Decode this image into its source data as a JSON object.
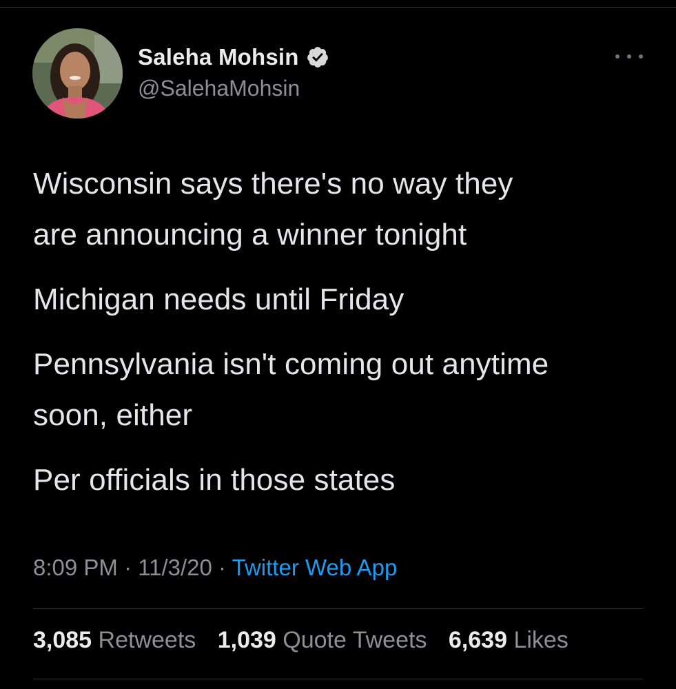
{
  "author": {
    "display_name": "Saleha Mohsin",
    "handle": "@SalehaMohsin",
    "verified": true,
    "verified_color": "#d9d9d9"
  },
  "menu": {
    "icon": "more-horizontal-icon"
  },
  "tweet": {
    "paragraphs": [
      "Wisconsin says there's no way they\nare announcing a winner tonight",
      "Michigan needs until Friday",
      "Pennsylvania isn't coming out anytime\nsoon, either",
      "Per officials in those states"
    ]
  },
  "meta": {
    "time": "8:09 PM",
    "separator": " · ",
    "date": "11/3/20",
    "source": "Twitter Web App"
  },
  "stats": {
    "retweets_count": "3,085",
    "retweets_label": "Retweets",
    "quotes_count": "1,039",
    "quotes_label": "Quote Tweets",
    "likes_count": "6,639",
    "likes_label": "Likes"
  },
  "colors": {
    "background": "#000000",
    "link": "#1d9bf0",
    "muted": "#8b9096",
    "divider": "#2f3336"
  }
}
